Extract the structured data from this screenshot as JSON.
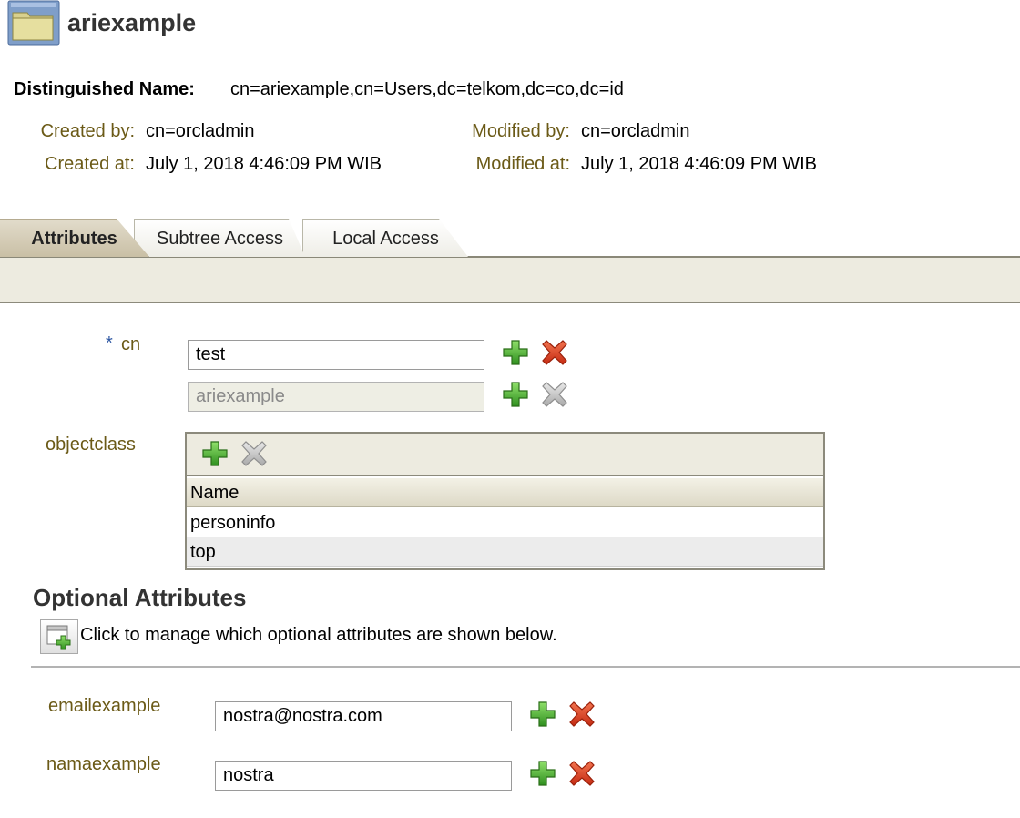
{
  "header": {
    "title": "ariexample",
    "icon": "folder-icon"
  },
  "dn": {
    "label": "Distinguished Name:",
    "value": "cn=ariexample,cn=Users,dc=telkom,dc=co,dc=id"
  },
  "meta": {
    "created_by_label": "Created by:",
    "created_by_value": "cn=orcladmin",
    "created_at_label": "Created at:",
    "created_at_value": "July 1, 2018 4:46:09 PM WIB",
    "modified_by_label": "Modified by:",
    "modified_by_value": "cn=orcladmin",
    "modified_at_label": "Modified at:",
    "modified_at_value": "July 1, 2018 4:46:09 PM WIB"
  },
  "tabs": [
    {
      "label": "Attributes",
      "active": true
    },
    {
      "label": "Subtree Access",
      "active": false
    },
    {
      "label": "Local Access",
      "active": false
    }
  ],
  "attributes": {
    "required_marker": "*",
    "cn_label": "cn",
    "cn_values": [
      {
        "value": "test",
        "editable": true
      },
      {
        "value": "ariexample",
        "editable": false
      }
    ],
    "objectclass_label": "objectclass",
    "objectclass_column": "Name",
    "objectclass_rows": [
      "personinfo",
      "top"
    ]
  },
  "optional": {
    "title": "Optional Attributes",
    "manage_text": "Click to manage which optional attributes are shown below.",
    "fields": [
      {
        "label": "emailexample",
        "value": "nostra@nostra.com"
      },
      {
        "label": "namaexample",
        "value": "nostra"
      }
    ]
  },
  "icons": {
    "add": "add-icon",
    "delete": "delete-icon",
    "delete_disabled": "delete-disabled-icon",
    "manage": "manage-attributes-icon"
  },
  "colors": {
    "label": "#6b5a17",
    "required": "#2f58a3",
    "add": "#3f9e2a",
    "delete": "#d63a1e"
  }
}
